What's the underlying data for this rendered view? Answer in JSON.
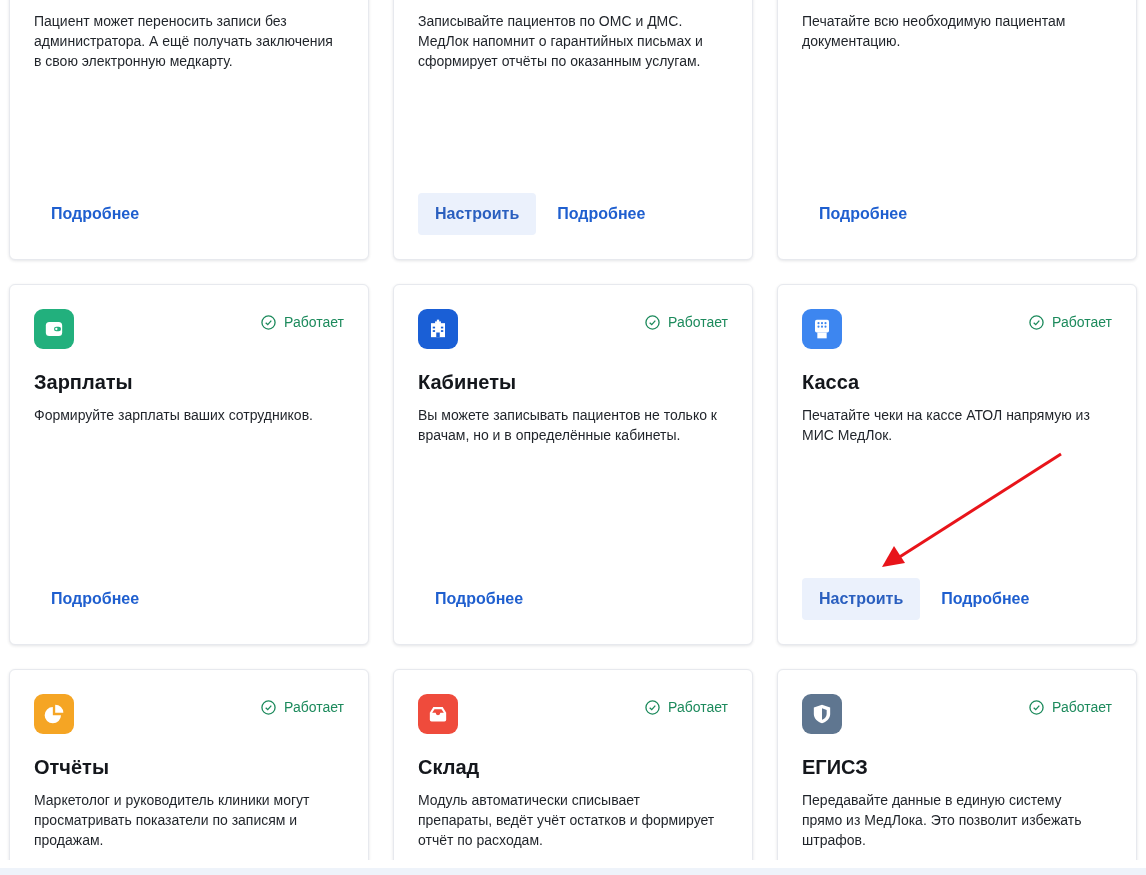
{
  "cards": [
    {
      "description": "Пациент может переносить записи без администратора. А ещё получать заключения в свою электронную медкарту.",
      "more_link": "Подробнее"
    },
    {
      "description": "Записывайте пациентов по ОМС и ДМС. МедЛок напомнит о гарантийных письмах и сформирует отчёты по оказанным услугам.",
      "configure_button": "Настроить",
      "more_link": "Подробнее"
    },
    {
      "description": "Печатайте всю необходимую пациентам документацию.",
      "more_link": "Подробнее"
    },
    {
      "color": "#22b07d",
      "status": "Работает",
      "title": "Зарплаты",
      "description": "Формируйте зарплаты ваших сотрудников.",
      "more_link": "Подробнее"
    },
    {
      "color": "#1a5fd6",
      "status": "Работает",
      "title": "Кабинеты",
      "description": "Вы можете записывать пациентов не только к врачам, но и в определённые кабинеты.",
      "more_link": "Подробнее"
    },
    {
      "color": "#3d86f0",
      "status": "Работает",
      "title": "Касса",
      "description": "Печатайте чеки на кассе АТОЛ напрямую из МИС МедЛок.",
      "configure_button": "Настроить",
      "more_link": "Подробнее"
    },
    {
      "color": "#f5a524",
      "status": "Работает",
      "title": "Отчёты",
      "description": "Маркетолог и руководитель клиники могут просматривать показатели по записям и продажам."
    },
    {
      "color": "#ef4b3c",
      "status": "Работает",
      "title": "Склад",
      "description": "Модуль автоматически списывает препараты, ведёт учёт остатков и формирует отчёт по расходам."
    },
    {
      "color": "#5f7690",
      "status": "Работает",
      "title": "ЕГИСЗ",
      "description": "Передавайте данные в единую систему прямо из МедЛока. Это позволит избежать штрафов."
    }
  ]
}
